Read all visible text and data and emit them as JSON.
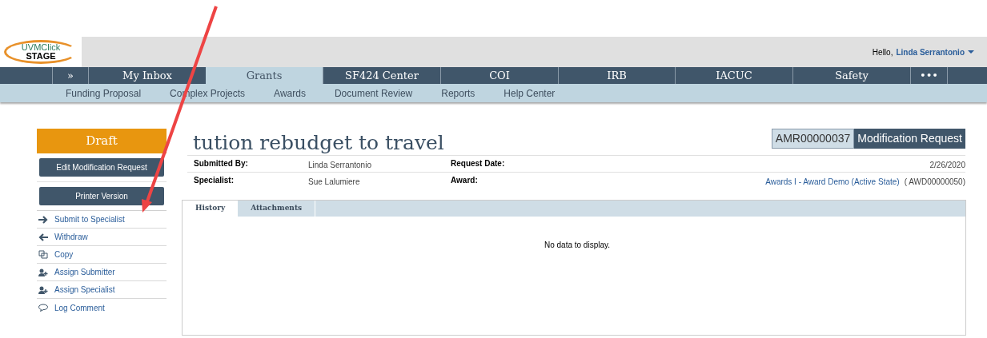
{
  "header": {
    "logo_top": "UVMClick",
    "logo_bottom": "STAGE",
    "greeting": "Hello,",
    "user": "Linda Serrantonio"
  },
  "nav": [
    {
      "label": "»",
      "selected": false
    },
    {
      "label": "My Inbox",
      "selected": false
    },
    {
      "label": "Grants",
      "selected": true
    },
    {
      "label": "SF424 Center",
      "selected": false
    },
    {
      "label": "COI",
      "selected": false
    },
    {
      "label": "IRB",
      "selected": false
    },
    {
      "label": "IACUC",
      "selected": false
    },
    {
      "label": "Safety",
      "selected": false
    },
    {
      "label": "•••",
      "selected": false
    }
  ],
  "subnav": [
    "Funding Proposal",
    "Complex Projects",
    "Awards",
    "Document Review",
    "Reports",
    "Help Center"
  ],
  "sidebar": {
    "state": "Draft",
    "buttons": [
      "Edit Modification Request",
      "Printer Version"
    ],
    "actions": [
      {
        "label": "Submit to Specialist",
        "kind": "arrow-right"
      },
      {
        "label": "Withdraw",
        "kind": "arrow-left"
      },
      {
        "label": "Copy",
        "kind": "copy"
      },
      {
        "label": "Assign Submitter",
        "kind": "user-add"
      },
      {
        "label": "Assign Specialist",
        "kind": "user-add"
      },
      {
        "label": "Log Comment",
        "kind": "comment"
      }
    ]
  },
  "record": {
    "title": "tution rebudget to travel",
    "id": "AMR00000037",
    "type": "Modification Request",
    "fields": [
      {
        "label": "Submitted By:",
        "value": "Linda Serrantonio",
        "label_2": "Request Date:",
        "value_2": "2/26/2020"
      },
      {
        "label": "Specialist:",
        "value": "Sue Lalumiere",
        "label_2": "Award:",
        "link": "Awards I - Award Demo (Active State)",
        "value_2": "( AWD00000050)"
      }
    ]
  },
  "tabs": [
    {
      "label": "History",
      "selected": true
    },
    {
      "label": "Attachments",
      "selected": false
    }
  ],
  "empty_message": "No data to display."
}
